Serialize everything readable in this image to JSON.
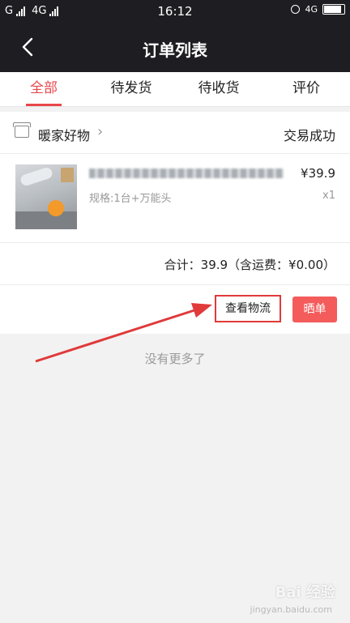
{
  "status_bar": {
    "carrier_left": "G",
    "network_2": "4G",
    "time": "16:12",
    "network_right": "4G"
  },
  "nav": {
    "title": "订单列表"
  },
  "tabs": [
    {
      "label": "全部",
      "active": true
    },
    {
      "label": "待发货",
      "active": false
    },
    {
      "label": "待收货",
      "active": false
    },
    {
      "label": "评价",
      "active": false
    }
  ],
  "order": {
    "shop_name": "暖家好物",
    "status": "交易成功",
    "product": {
      "spec": "规格:1台+万能头",
      "price": "¥39.9",
      "quantity": "x1"
    },
    "total": "合计：39.9（含运费：¥0.00）",
    "actions": {
      "logistics": "查看物流",
      "share": "晒单"
    }
  },
  "footer": {
    "no_more": "没有更多了"
  },
  "watermark": {
    "text": "Bai 经验",
    "sub": "jingyan.baidu.com"
  },
  "colors": {
    "accent": "#e8474b",
    "header_bg": "#1e1e22",
    "share_button": "#f45c5c",
    "highlight_box": "#e03a3a"
  }
}
